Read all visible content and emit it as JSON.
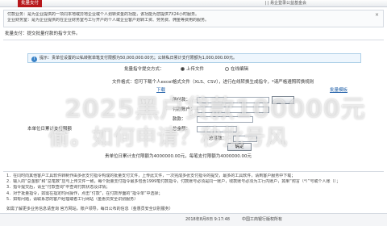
{
  "topbar": {
    "active_tab": "批量支付",
    "right_text": "|  |  易企登录公益基金会"
  },
  "intro": {
    "line1": "付款业务：是为企业提供的一项同本地或异地企业或个人划转资金的功能，该功能为您提供7X24小时服务。",
    "line2": "企业财务室：是为企业提供的在企业财务室与工行开户的个人或企业客户划转工资、劳务费、佣金等费用的服务。"
  },
  "breadcrumb": "批量支付：提交批量付款的指令文件。",
  "hint": {
    "icon": "i",
    "text": "提示：贵单位设置的公私转账单笔支付限额为50,000,000.00元；公转私日累计支付限额为1,000,000.00元。"
  },
  "form": {
    "method_label": "批量指令提交方式：",
    "method_upload": "上传文件",
    "method_online": "在线编辑",
    "file_note": "文件格式：您可下载个人excel格式文件（XLS、CSV），进行在线转换生成指令，*请严格遵照转换规则",
    "download_link": "下载",
    "template_link": "批量模板",
    "row1_label": "所付款：",
    "row2_label": "付款账户：",
    "row3_label": "款款：",
    "row4_label": "总金额：",
    "row5_label": "总笔数：",
    "side_label": "本单位日累计支付限额",
    "confirm_button": "确定",
    "limit_text": "贵单位日累计支付限额为4000000.00元，每笔支付限额为4000000.00元"
  },
  "notes": [
    "1．在同时向其他客户工具软件转制作由多张支付指令构成的批量支付文件，上传此文件，一次完成多张支付指令的提交，最多的工具软件，请到客户服务中下载；",
    "2．输入的“总金额”和“总笔数”应与上传文件一致，每个批量支付指令最多包含1999笔付款指令，付款账号必须是同一账户，收款账号必须为工行内账户，如果“附言（*）”号或个人账（）；",
    "3．指令提交后，请至“付款查询”中查询付款状态及详情；",
    "4．对于批量指令，如需在指定时间操作，点击“付款”，在付款界面的“指令单”中选择；",
    "5．如有问题，请联系您的客户经理或者工行网站（金惠员安全识别服务）"
  ],
  "footer_link": "如需了解更多业务信息请查询 官方网站，账户领导，每日公布的信息（金惠员安全识别服务）",
  "footer": {
    "time": "2018年8月8日 9:17:48",
    "bank": "中国工商银行版权所有"
  },
  "watermark": {
    "line1": "2025黑户贷款100000元",
    "line2": "偷。如何申请？秒批号风"
  },
  "colors": {
    "active_tab": "#b7171b",
    "hint_bg": "#eef6fd",
    "link": "#1f5fa8"
  }
}
